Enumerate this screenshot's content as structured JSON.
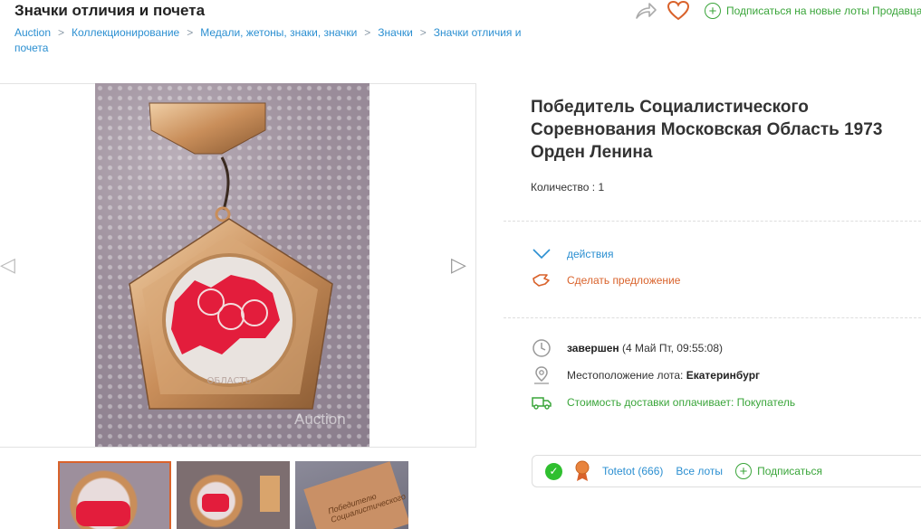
{
  "header": {
    "title": "Значки отличия и почета",
    "breadcrumb": [
      "Auction",
      "Коллекционирование",
      "Медали, жетоны, знаки, значки",
      "Значки",
      "Значки отличия и почета"
    ],
    "subscribe_label": "Подписаться на новые лоты Продавца"
  },
  "gallery": {
    "watermark": "Auction",
    "medal_text": "ОБЛАСТЬ",
    "thumb_text": "Победителю Социалистического"
  },
  "lot": {
    "title": "Победитель Социалистического Соревнования Московская Область 1973 Орден Ленина",
    "quantity_label": "Количество :",
    "quantity_value": "1",
    "actions_label": "действия",
    "offer_label": "Сделать предложение",
    "status_bold": "завершен",
    "status_detail": "(4 Май Пт, 09:55:08)",
    "location_label": "Местоположение лота:",
    "location_value": "Екатеринбург",
    "delivery_label": "Стоимость доставки оплачивает: Покупатель"
  },
  "seller": {
    "name": "Totetot (666)",
    "all_lots": "Все лоты",
    "subscribe": "Подписаться"
  },
  "colors": {
    "link": "#2b8fd1",
    "accent": "#d9622b",
    "green": "#3aa53a"
  }
}
